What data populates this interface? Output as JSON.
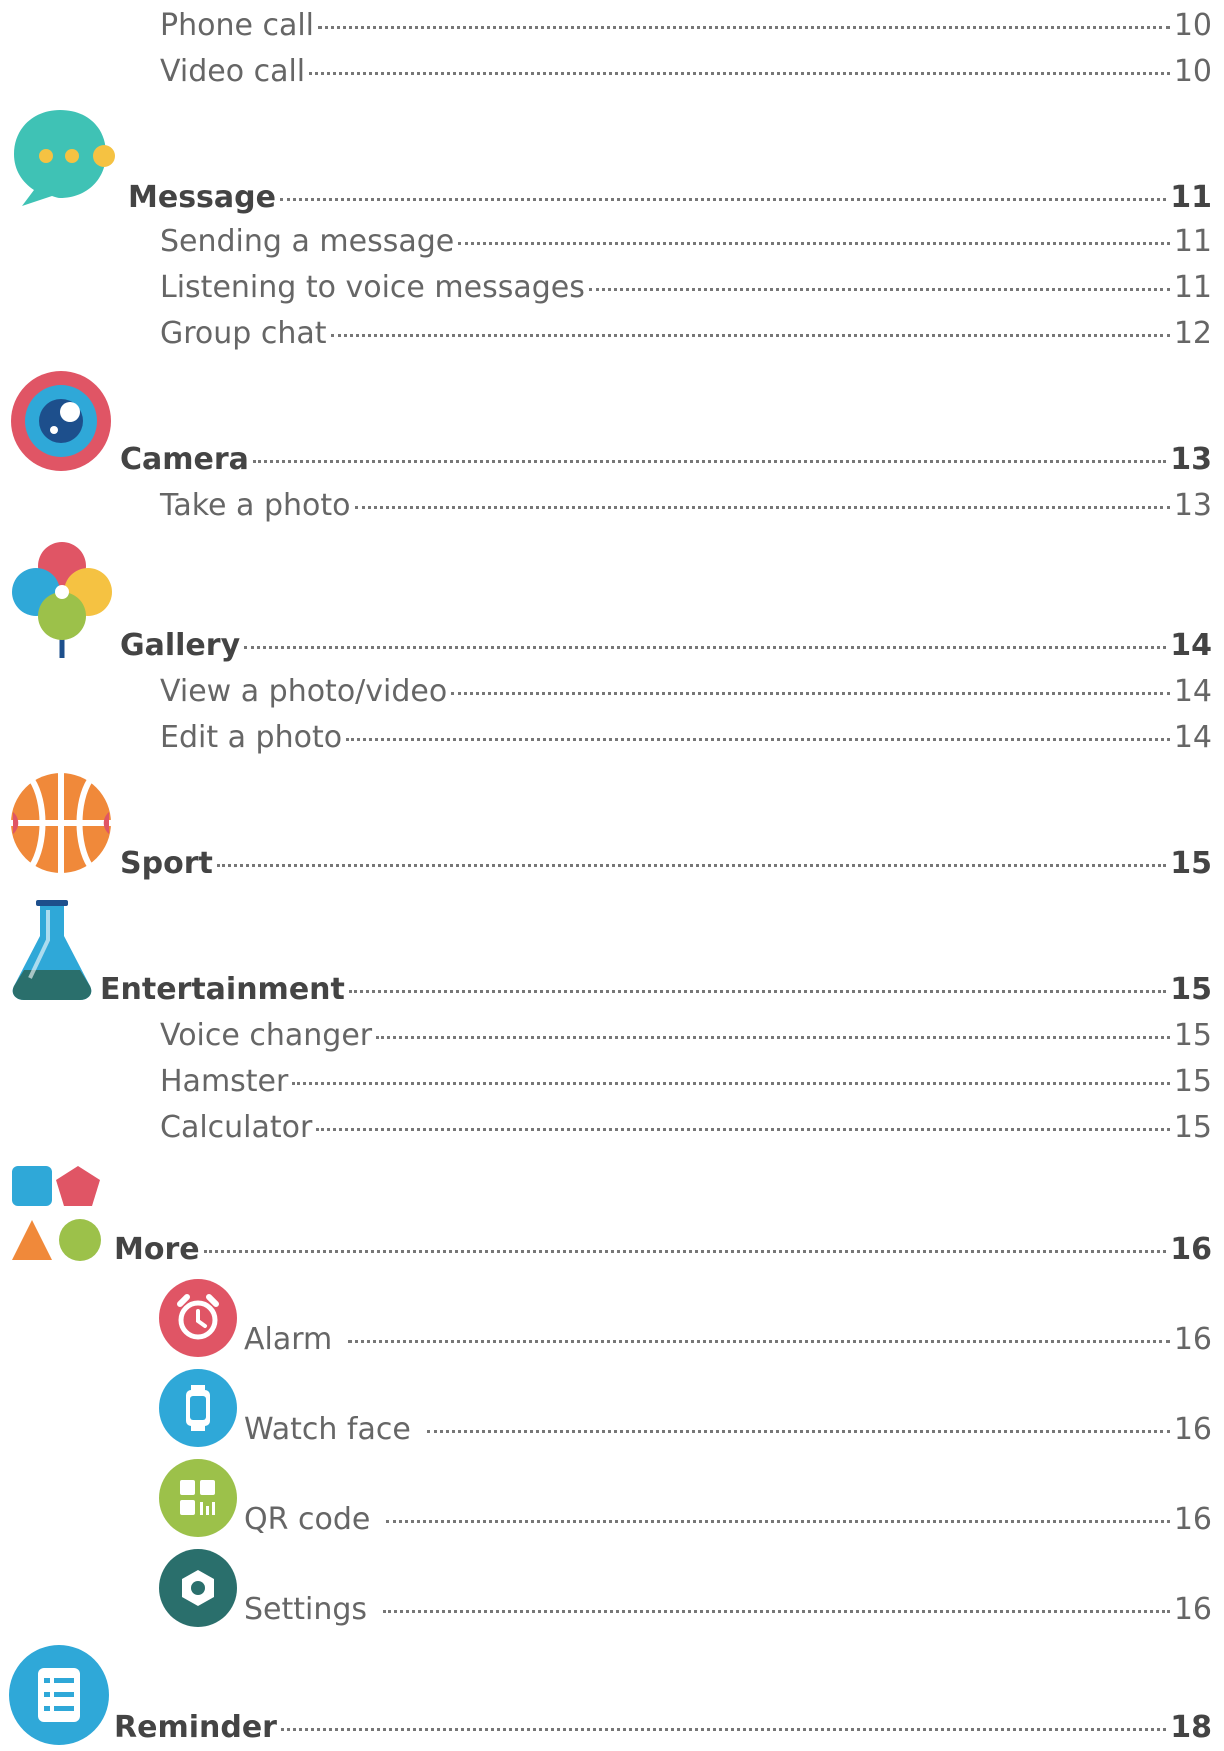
{
  "toc": {
    "phone_call": {
      "title": "Phone call",
      "page": "10"
    },
    "video_call": {
      "title": "Video call",
      "page": "10"
    },
    "message": {
      "title": "Message",
      "page": "11"
    },
    "sending_message": {
      "title": "Sending a message",
      "page": "11"
    },
    "listening_voice": {
      "title": "Listening to voice messages",
      "page": "11"
    },
    "group_chat": {
      "title": "Group chat",
      "page": "12"
    },
    "camera": {
      "title": "Camera",
      "page": "13"
    },
    "take_photo": {
      "title": "Take a photo",
      "page": "13"
    },
    "gallery": {
      "title": "Gallery",
      "page": "14"
    },
    "view_photo_video": {
      "title": "View a photo/video",
      "page": "14"
    },
    "edit_photo": {
      "title": "Edit a photo",
      "page": "14"
    },
    "sport": {
      "title": "Sport",
      "page": "15"
    },
    "entertainment": {
      "title": "Entertainment",
      "page": "15"
    },
    "voice_changer": {
      "title": "Voice changer",
      "page": "15"
    },
    "hamster": {
      "title": "Hamster",
      "page": "15"
    },
    "calculator": {
      "title": "Calculator",
      "page": "15"
    },
    "more": {
      "title": "More",
      "page": "16"
    },
    "alarm": {
      "title": "Alarm",
      "page": "16"
    },
    "watch_face": {
      "title": "Watch face",
      "page": "16"
    },
    "qr_code": {
      "title": "QR code",
      "page": "16"
    },
    "settings": {
      "title": "Settings",
      "page": "16"
    },
    "reminder": {
      "title": "Reminder",
      "page": "18"
    }
  },
  "icons": {
    "message": "chat-bubble-icon",
    "camera": "camera-lens-icon",
    "gallery": "balloons-icon",
    "sport": "basketball-icon",
    "entertainment": "flask-icon",
    "more": "shapes-icon",
    "alarm": "alarm-clock-icon",
    "watch_face": "watch-icon",
    "qr_code": "qr-code-icon",
    "settings": "settings-gear-icon",
    "reminder": "checklist-icon"
  },
  "colors": {
    "teal": "#3fc2b5",
    "yellow": "#f5c242",
    "red": "#e05565",
    "blue": "#2fa8d8",
    "orange": "#f0893a",
    "green": "#9cc14a",
    "dark_teal": "#2a6f6c"
  }
}
